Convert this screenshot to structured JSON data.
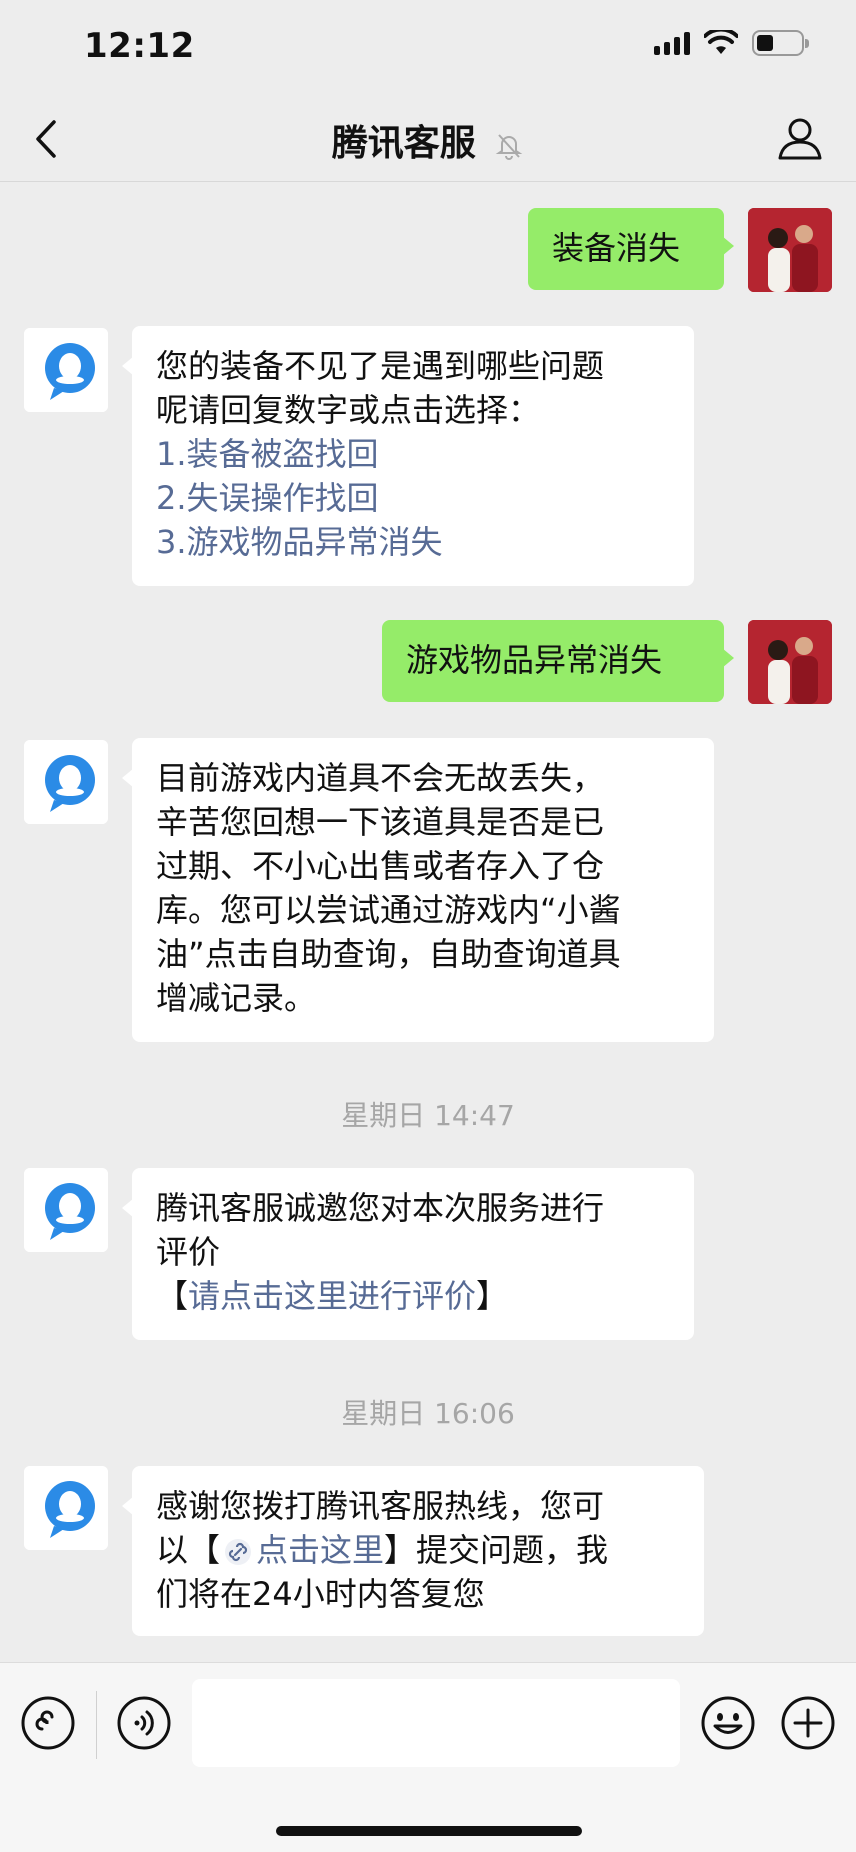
{
  "status_bar": {
    "time": "12:12"
  },
  "nav": {
    "title": "腾讯客服"
  },
  "messages": {
    "m1": "装备消失",
    "m2": {
      "line1": "您的装备不见了是遇到哪些问题",
      "line2": "呢请回复数字或点击选择：",
      "opt1": "1.装备被盗找回",
      "opt2": "2.失误操作找回",
      "opt3": "3.游戏物品异常消失"
    },
    "m3": "游戏物品异常消失",
    "m4": {
      "l1": "目前游戏内道具不会无故丢失，",
      "l2": "辛苦您回想一下该道具是否是已",
      "l3": "过期、不小心出售或者存入了仓",
      "l4": "库。您可以尝试通过游戏内“小酱",
      "l5": "油”点击自助查询，自助查询道具",
      "l6": "增减记录。"
    },
    "ts1": "星期日 14:47",
    "m5": {
      "l1": "腾讯客服诚邀您对本次服务进行",
      "l2": "评价",
      "link_open": "【",
      "link": "请点击这里进行评价",
      "link_close": "】"
    },
    "ts2": "星期日 16:06",
    "m6": {
      "l1": "感谢您拨打腾讯客服热线，您可",
      "l2a": "以【",
      "l2link": "点击这里",
      "l2b": "】提交问题，我",
      "l3": "们将在24小时内答复您"
    }
  },
  "input": {
    "placeholder": ""
  },
  "colors": {
    "outgoing_bubble": "#95ec69",
    "incoming_bubble": "#ffffff",
    "link": "#576b95",
    "background": "#ededed"
  },
  "icons": [
    "signal-icon",
    "wifi-icon",
    "battery-icon",
    "back-icon",
    "mute-bell-icon",
    "profile-icon",
    "mini-program-icon",
    "voice-icon",
    "emoji-icon",
    "plus-icon",
    "link-icon"
  ]
}
